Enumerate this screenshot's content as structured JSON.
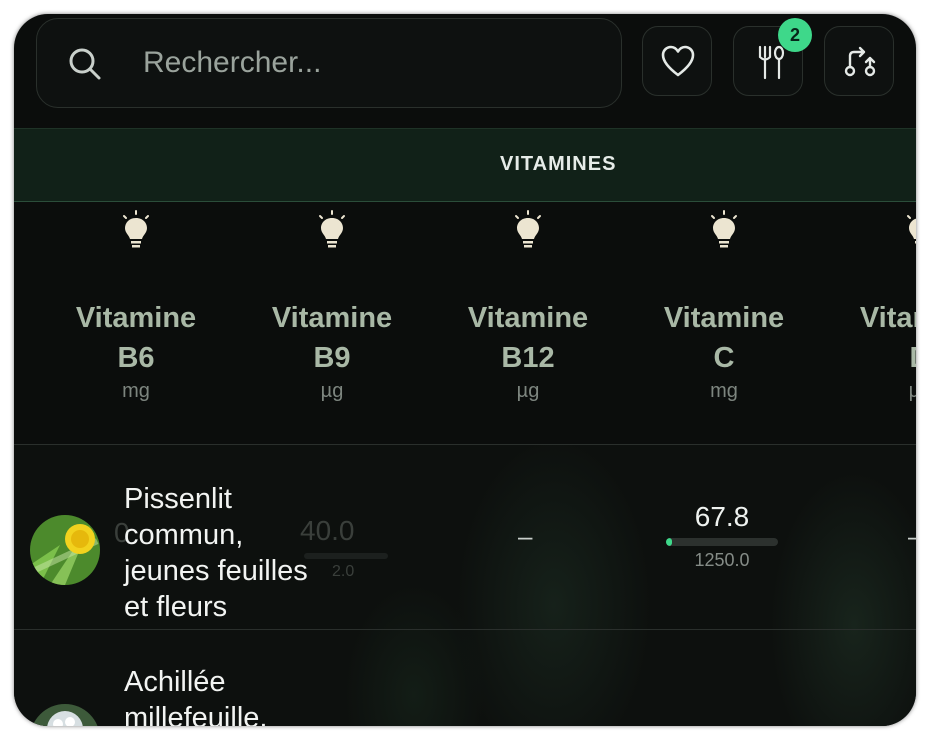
{
  "search": {
    "placeholder": "Rechercher..."
  },
  "toolbar": {
    "cart_badge": "2"
  },
  "section": {
    "title": "VITAMINES"
  },
  "columns": [
    {
      "name_line1": "Vitamine",
      "name_line2": "B6",
      "unit": "mg"
    },
    {
      "name_line1": "Vitamine",
      "name_line2": "B9",
      "unit": "µg"
    },
    {
      "name_line1": "Vitamine",
      "name_line2": "B12",
      "unit": "µg"
    },
    {
      "name_line1": "Vitamine",
      "name_line2": "C",
      "unit": "mg"
    },
    {
      "name_line1": "Vitamine",
      "name_line2": "D",
      "unit": "µg"
    }
  ],
  "rows": [
    {
      "name_lines": [
        "Pissenlit",
        "commun,",
        "jeunes feuilles",
        "et fleurs"
      ],
      "b6_ghost": "0",
      "b9_value": "40.0",
      "b9_ref": "2.0",
      "b12_value": "–",
      "c_value": "67.8",
      "c_ref": "1250.0",
      "c_fill": 0.054,
      "d_value": "–"
    },
    {
      "name_lines": [
        "Achillée",
        "millefeuille,",
        "..."
      ]
    }
  ],
  "colors": {
    "accent": "#3ed88a",
    "section_bg": "#112118",
    "label": "#a9b8a6"
  }
}
